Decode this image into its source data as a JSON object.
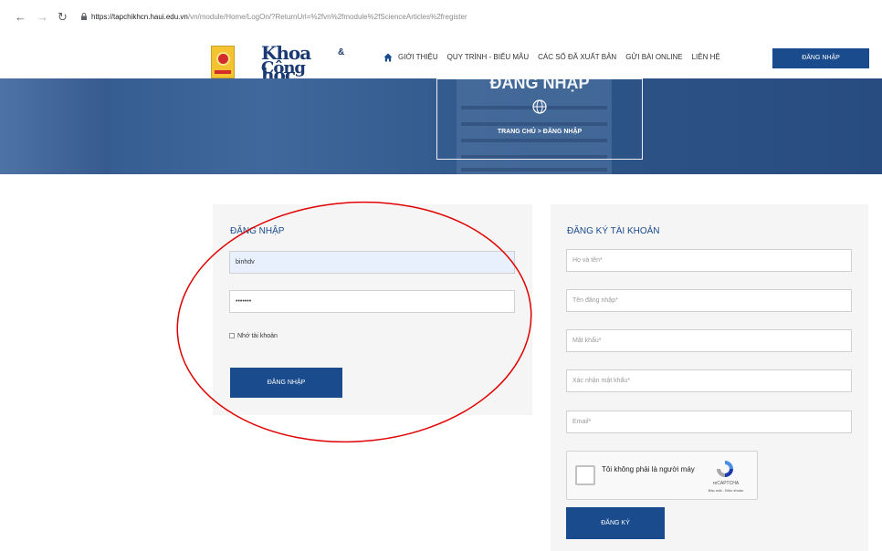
{
  "browser": {
    "back_icon": "back-arrow-icon",
    "forward_icon": "forward-arrow-icon",
    "reload_icon": "reload-icon",
    "url_host": "https://tapchikhcn.haui.edu.vn",
    "url_path": "/vn/module/Home/LogOn/?ReturnUrl=%2fvn%2fmodule%2fScienceArticles%2fregister"
  },
  "header": {
    "logo_line1": "Khoa học",
    "logo_amp": "&",
    "logo_line2": "Công nghệ",
    "nav": [
      {
        "label": "GIỚI THIỆU"
      },
      {
        "label": "QUY TRÌNH - BIỂU MẪU"
      },
      {
        "label": "CÁC SỐ ĐÃ XUẤT BẢN"
      },
      {
        "label": "GỬI BÀI ONLINE"
      },
      {
        "label": "LIÊN HỆ"
      }
    ],
    "login_label": "ĐĂNG NHẬP"
  },
  "banner": {
    "title": "ĐĂNG NHẬP",
    "breadcrumb_home": "TRANG CHỦ",
    "breadcrumb_sep": " > ",
    "breadcrumb_current": "ĐĂNG NHẬP"
  },
  "login": {
    "heading": "ĐĂNG NHẬP",
    "username_value": "binhdv",
    "password_value": "•••••••",
    "remember_label": "Nhớ tài khoản",
    "submit_label": "ĐĂNG NHẬP"
  },
  "register": {
    "heading": "ĐĂNG KÝ TÀI KHOẢN",
    "fullname_placeholder": "Họ và tên*",
    "username_placeholder": "Tên đăng nhập*",
    "password_placeholder": "Mật khẩu*",
    "confirm_placeholder": "Xác nhận mật khẩu*",
    "email_placeholder": "Email*",
    "captcha_label": "Tôi không phải là người máy",
    "captcha_brand": "reCAPTCHA",
    "captcha_links": "Bảo mật - Điều khoản",
    "submit_label": "ĐĂNG KÝ"
  },
  "colors": {
    "primary": "#1a4b8c",
    "annotation": "#e00000"
  }
}
